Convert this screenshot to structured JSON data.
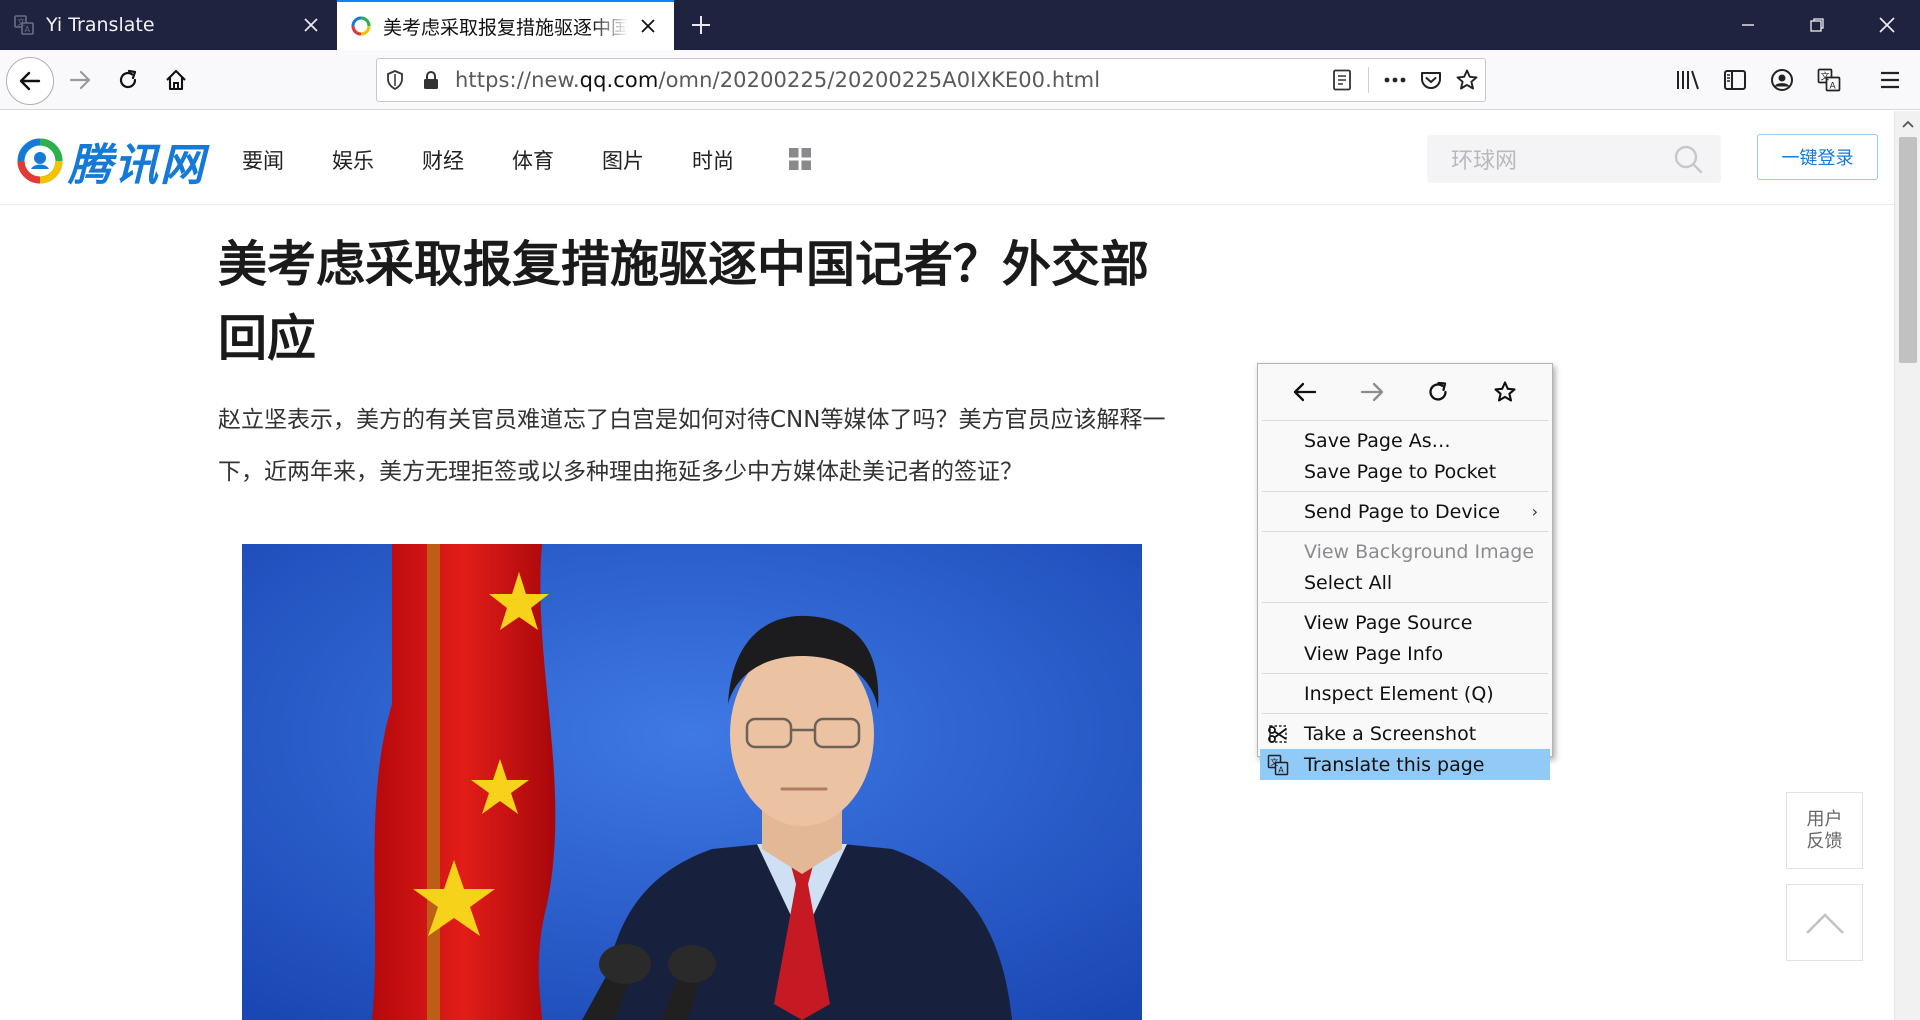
{
  "browser": {
    "tabs": [
      {
        "title": "Yi Translate",
        "active": false
      },
      {
        "title": "美考虑采取报复措施驱逐中国记者？外交部回应",
        "active": true
      }
    ],
    "url": {
      "scheme": "https://new.",
      "domain": "qq.com",
      "path": "/omn/20200225/20200225A0IXKE00.html"
    },
    "accent_color": "#0a84ff"
  },
  "site": {
    "logo_text": "腾讯网",
    "channels": [
      "要闻",
      "娱乐",
      "财经",
      "体育",
      "图片",
      "时尚"
    ],
    "search_placeholder": "环球网",
    "login_label": "一键登录",
    "brand_color": "#1479d7"
  },
  "article": {
    "headline": "美考虑采取报复措施驱逐中国记者？外交部回应",
    "summary": "赵立坚表示，美方的有关官员难道忘了白宫是如何对待CNN等媒体了吗？美方官员应该解释一下，近两年来，美方无理拒签或以多种理由拖延多少中方媒体赴美记者的签证？"
  },
  "side_widgets": {
    "feedback_line1": "用户",
    "feedback_line2": "反馈"
  },
  "context_menu": {
    "groups": [
      [
        {
          "label": "Save Page As…",
          "enabled": true
        },
        {
          "label": "Save Page to Pocket",
          "enabled": true
        }
      ],
      [
        {
          "label": "Send Page to Device",
          "enabled": true,
          "submenu": true
        }
      ],
      [
        {
          "label": "View Background Image",
          "enabled": false
        },
        {
          "label": "Select All",
          "enabled": true
        }
      ],
      [
        {
          "label": "View Page Source",
          "enabled": true
        },
        {
          "label": "View Page Info",
          "enabled": true
        }
      ],
      [
        {
          "label": "Inspect Element (Q)",
          "enabled": true
        }
      ],
      [
        {
          "label": "Take a Screenshot",
          "enabled": true,
          "icon": "screenshot-icon"
        },
        {
          "label": "Translate this page",
          "enabled": true,
          "icon": "translate-icon",
          "highlighted": true
        }
      ]
    ],
    "highlight_color": "#91c9f7"
  }
}
